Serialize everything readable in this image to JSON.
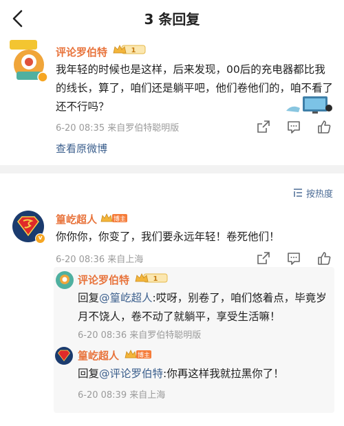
{
  "header": {
    "title": "3 条回复"
  },
  "main_comment": {
    "author": "评论罗伯特",
    "level": "1",
    "text": "我年轻的时候也是这样，后来发现，00后的充电器都比我的线长，算了，咱们还是躺平吧，他们卷他们的，咱不看了还不行吗？",
    "meta": "6-20 08:35  来自罗伯特聪明版",
    "view_original": "查看原微博"
  },
  "sort": {
    "label": "按热度"
  },
  "replies": [
    {
      "author": "篁屹超人",
      "badge": "博主",
      "text": "你你你，你变了，我们要永远年轻！卷死他们！",
      "meta": "6-20 08:36  来自上海"
    },
    {
      "author": "评论罗伯特",
      "level": "1",
      "prefix": "回复",
      "mention": "@篁屹超人",
      "text": ":哎呀，别卷了，咱们悠着点，毕竟岁月不饶人，卷不动了就躺平，享受生活嘛！",
      "meta": "6-20 08:36  来自罗伯特聪明版"
    },
    {
      "author": "篁屹超人",
      "badge": "博主",
      "prefix": "回复",
      "mention": "@评论罗伯特",
      "text": ":你再这样我就拉黑你了！",
      "meta": "6-20 08:39  来自上海"
    }
  ],
  "colors": {
    "name": "#e8733b",
    "link": "#3a5e8c",
    "meta": "#9a9a9a"
  }
}
